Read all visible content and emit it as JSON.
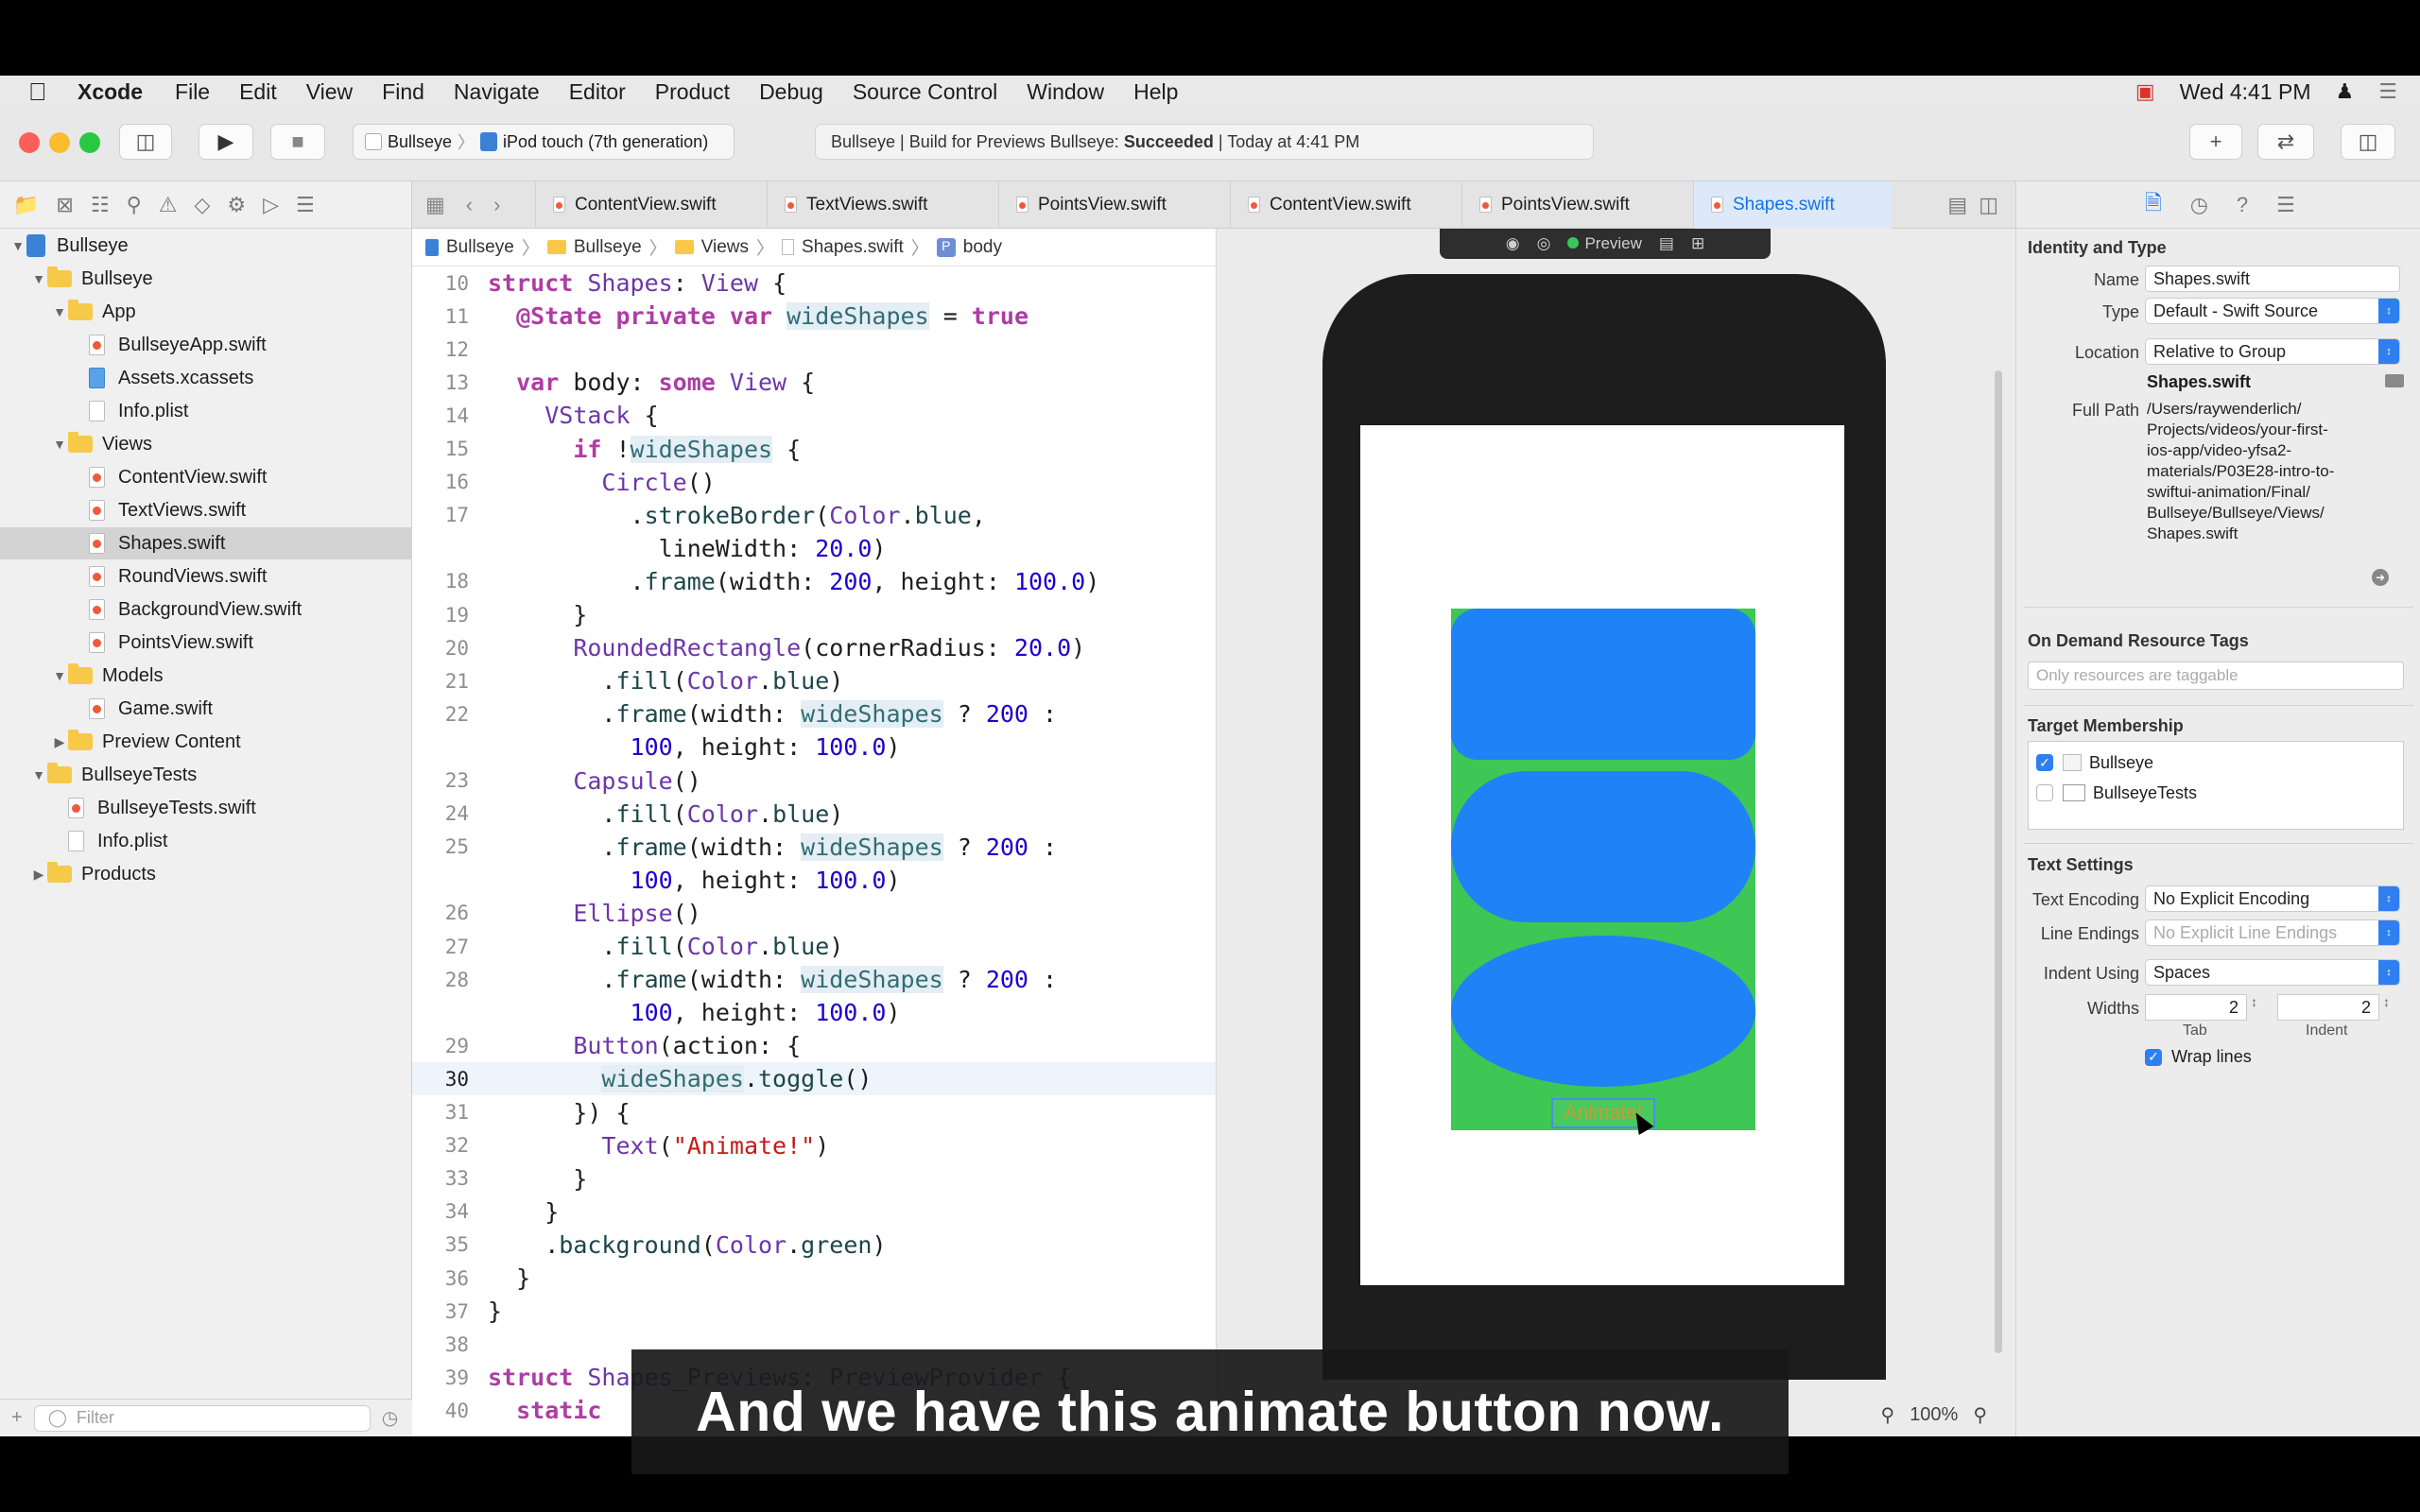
{
  "menubar": {
    "app": "Xcode",
    "items": [
      "File",
      "Edit",
      "View",
      "Find",
      "Navigate",
      "Editor",
      "Product",
      "Debug",
      "Source Control",
      "Window",
      "Help"
    ],
    "clock": "Wed 4:41 PM"
  },
  "toolbar": {
    "scheme": "Bullseye",
    "device": "iPod touch (7th generation)",
    "activity_prefix": "Bullseye | Build for Previews Bullseye: ",
    "activity_status": "Succeeded",
    "activity_suffix": " | Today at 4:41 PM"
  },
  "navigator": {
    "items": [
      {
        "label": "Bullseye",
        "kind": "project",
        "indent": 0,
        "open": true
      },
      {
        "label": "Bullseye",
        "kind": "folder",
        "indent": 1,
        "open": true
      },
      {
        "label": "App",
        "kind": "folder",
        "indent": 2,
        "open": true
      },
      {
        "label": "BullseyeApp.swift",
        "kind": "swift",
        "indent": 3
      },
      {
        "label": "Assets.xcassets",
        "kind": "assets",
        "indent": 3
      },
      {
        "label": "Info.plist",
        "kind": "plist",
        "indent": 3
      },
      {
        "label": "Views",
        "kind": "folder",
        "indent": 2,
        "open": true
      },
      {
        "label": "ContentView.swift",
        "kind": "swift",
        "indent": 3
      },
      {
        "label": "TextViews.swift",
        "kind": "swift",
        "indent": 3
      },
      {
        "label": "Shapes.swift",
        "kind": "swift",
        "indent": 3,
        "selected": true
      },
      {
        "label": "RoundViews.swift",
        "kind": "swift",
        "indent": 3
      },
      {
        "label": "BackgroundView.swift",
        "kind": "swift",
        "indent": 3
      },
      {
        "label": "PointsView.swift",
        "kind": "swift",
        "indent": 3
      },
      {
        "label": "Models",
        "kind": "folder",
        "indent": 2,
        "open": true
      },
      {
        "label": "Game.swift",
        "kind": "swift",
        "indent": 3
      },
      {
        "label": "Preview Content",
        "kind": "folder",
        "indent": 2,
        "open": false
      },
      {
        "label": "BullseyeTests",
        "kind": "folder",
        "indent": 1,
        "open": true
      },
      {
        "label": "BullseyeTests.swift",
        "kind": "swift",
        "indent": 2
      },
      {
        "label": "Info.plist",
        "kind": "plist",
        "indent": 2
      },
      {
        "label": "Products",
        "kind": "folder",
        "indent": 1,
        "open": false
      }
    ],
    "filter_placeholder": "Filter"
  },
  "tabs": [
    {
      "label": "ContentView.swift",
      "active": false
    },
    {
      "label": "TextViews.swift",
      "active": false
    },
    {
      "label": "PointsView.swift",
      "active": false
    },
    {
      "label": "ContentView.swift",
      "active": false
    },
    {
      "label": "PointsView.swift",
      "active": false
    },
    {
      "label": "Shapes.swift",
      "active": true
    }
  ],
  "jumpbar": [
    "Bullseye",
    "Bullseye",
    "Views",
    "Shapes.swift",
    "body"
  ],
  "code": [
    {
      "n": "10",
      "html": "<span class='kw'>struct</span> <span class='ty'>Shapes</span>: <span class='ty'>View</span> {"
    },
    {
      "n": "11",
      "html": "  <span class='kw'>@State</span> <span class='kw'>private</span> <span class='kw'>var</span> <span class='hl'>wideShapes</span> = <span class='kw'>true</span>"
    },
    {
      "n": "12",
      "html": ""
    },
    {
      "n": "13",
      "html": "  <span class='kw'>var</span> body: <span class='kw'>some</span> <span class='ty'>View</span> {"
    },
    {
      "n": "14",
      "html": "    <span class='ty'>VStack</span> {"
    },
    {
      "n": "15",
      "html": "      <span class='kw'>if</span> !<span class='hl'>wideShapes</span> {"
    },
    {
      "n": "16",
      "html": "        <span class='ty'>Circle</span>()"
    },
    {
      "n": "17",
      "html": "          .<span class='nm'>strokeBorder</span>(<span class='ty'>Color</span>.<span class='nm'>blue</span>,"
    },
    {
      "n": "",
      "html": "            lineWidth: <span class='num'>20.0</span>)"
    },
    {
      "n": "18",
      "html": "          .<span class='nm'>frame</span>(width: <span class='num'>200</span>, height: <span class='num'>100.0</span>)"
    },
    {
      "n": "19",
      "html": "      }"
    },
    {
      "n": "20",
      "html": "      <span class='ty'>RoundedRectangle</span>(cornerRadius: <span class='num'>20.0</span>)"
    },
    {
      "n": "21",
      "html": "        .<span class='nm'>fill</span>(<span class='ty'>Color</span>.<span class='nm'>blue</span>)"
    },
    {
      "n": "22",
      "html": "        .<span class='nm'>frame</span>(width: <span class='hl'>wideShapes</span> ? <span class='num'>200</span> :"
    },
    {
      "n": "",
      "html": "          <span class='num'>100</span>, height: <span class='num'>100.0</span>)"
    },
    {
      "n": "23",
      "html": "      <span class='ty'>Capsule</span>()"
    },
    {
      "n": "24",
      "html": "        .<span class='nm'>fill</span>(<span class='ty'>Color</span>.<span class='nm'>blue</span>)"
    },
    {
      "n": "25",
      "html": "        .<span class='nm'>frame</span>(width: <span class='hl'>wideShapes</span> ? <span class='num'>200</span> :"
    },
    {
      "n": "",
      "html": "          <span class='num'>100</span>, height: <span class='num'>100.0</span>)"
    },
    {
      "n": "26",
      "html": "      <span class='ty'>Ellipse</span>()"
    },
    {
      "n": "27",
      "html": "        .<span class='nm'>fill</span>(<span class='ty'>Color</span>.<span class='nm'>blue</span>)"
    },
    {
      "n": "28",
      "html": "        .<span class='nm'>frame</span>(width: <span class='hl'>wideShapes</span> ? <span class='num'>200</span> :"
    },
    {
      "n": "",
      "html": "          <span class='num'>100</span>, height: <span class='num'>100.0</span>)"
    },
    {
      "n": "29",
      "html": "      <span class='ty'>Button</span>(action: {"
    },
    {
      "n": "30",
      "html": "        <span class='hl'>wideShapes</span>.<span class='nm'>toggle</span>()",
      "current": true
    },
    {
      "n": "31",
      "html": "      }) {"
    },
    {
      "n": "32",
      "html": "        <span class='ty'>Text</span>(<span class='str'>\"Animate!\"</span>)"
    },
    {
      "n": "33",
      "html": "      }"
    },
    {
      "n": "34",
      "html": "    }"
    },
    {
      "n": "35",
      "html": "    .<span class='nm'>background</span>(<span class='ty'>Color</span>.<span class='nm'>green</span>)"
    },
    {
      "n": "36",
      "html": "  }"
    },
    {
      "n": "37",
      "html": "}"
    },
    {
      "n": "38",
      "html": ""
    },
    {
      "n": "39",
      "html": "<span class='kw'>struct</span> <span class='ty'>Shapes_Previews</span>: <span class='ty'>PreviewProvider</span> {"
    },
    {
      "n": "40",
      "html": "  <span class='kw'>static</span>"
    }
  ],
  "canvas": {
    "preview_label": "Preview",
    "button_label": "Animate!",
    "zoom": "100%"
  },
  "inspector": {
    "identity_title": "Identity and Type",
    "name_label": "Name",
    "name_value": "Shapes.swift",
    "type_label": "Type",
    "type_value": "Default - Swift Source",
    "location_label": "Location",
    "location_value": "Relative to Group",
    "location_file": "Shapes.swift",
    "fullpath_label": "Full Path",
    "fullpath_lines": [
      "/Users/raywenderlich/",
      "Projects/videos/your-first-",
      "ios-app/video-yfsa2-",
      "materials/P03E28-intro-to-",
      "swiftui-animation/Final/",
      "Bullseye/Bullseye/Views/",
      "Shapes.swift"
    ],
    "odr_title": "On Demand Resource Tags",
    "odr_placeholder": "Only resources are taggable",
    "target_title": "Target Membership",
    "targets": [
      {
        "label": "Bullseye",
        "checked": true
      },
      {
        "label": "BullseyeTests",
        "checked": false
      }
    ],
    "text_title": "Text Settings",
    "encoding_label": "Text Encoding",
    "encoding_value": "No Explicit Encoding",
    "endings_label": "Line Endings",
    "endings_value": "No Explicit Line Endings",
    "indent_label": "Indent Using",
    "indent_value": "Spaces",
    "widths_label": "Widths",
    "tab_width": "2",
    "indent_width": "2",
    "tab_caption": "Tab",
    "indent_caption": "Indent",
    "wrap_label": "Wrap lines",
    "wrap_checked": true
  },
  "caption": "And we have this animate button now."
}
